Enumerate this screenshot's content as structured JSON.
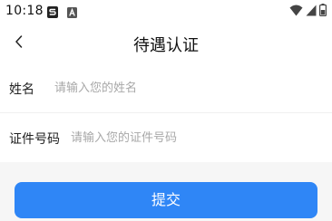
{
  "status_bar": {
    "time": "10:18",
    "left_icons": [
      "app-s-icon",
      "app-a-icon"
    ],
    "right_icons": [
      "wifi-icon",
      "signal-icon",
      "battery-icon"
    ]
  },
  "nav": {
    "title": "待遇认证",
    "back_icon": "chevron-left-icon"
  },
  "form": {
    "name": {
      "label": "姓名",
      "value": "",
      "placeholder": "请输入您的姓名"
    },
    "id_number": {
      "label": "证件号码",
      "value": "",
      "placeholder": "请输入您的证件号码"
    }
  },
  "actions": {
    "submit_label": "提交"
  },
  "colors": {
    "accent": "#2f86f6",
    "placeholder": "#a8a8a8",
    "footer_background": "#f6f6f6"
  }
}
